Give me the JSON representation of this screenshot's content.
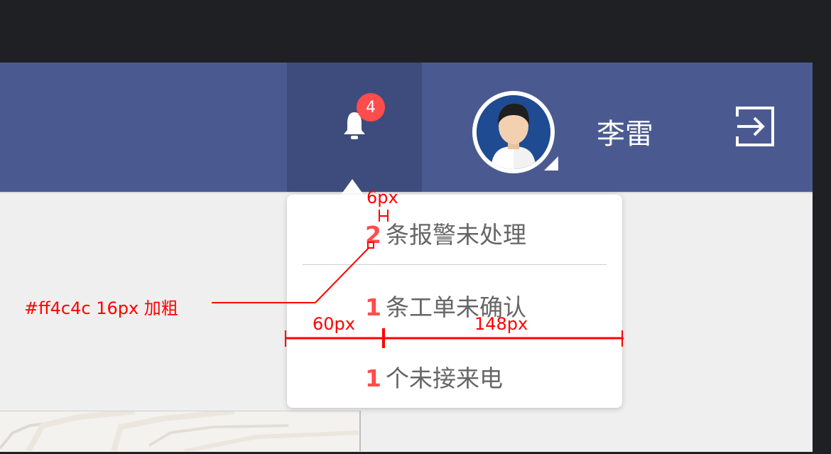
{
  "header": {
    "notification_count": "4",
    "user_name": "李雷"
  },
  "alerts": [
    {
      "count": "2",
      "text": "条报警未处理"
    },
    {
      "count": "1",
      "text": "条工单未确认"
    },
    {
      "count": "1",
      "text": "个未接来电"
    }
  ],
  "annotations": {
    "spacing_label": "6px",
    "style_note": "#ff4c4c  16px 加粗",
    "left_width_label": "60px",
    "right_width_label": "148px"
  },
  "colors": {
    "accent": "#ff4c4c",
    "header_bg": "#4a5a91",
    "bell_bg": "#3d4c7d"
  },
  "icons": {
    "bell": "bell-icon",
    "avatar": "user-avatar",
    "logout": "logout-icon"
  }
}
